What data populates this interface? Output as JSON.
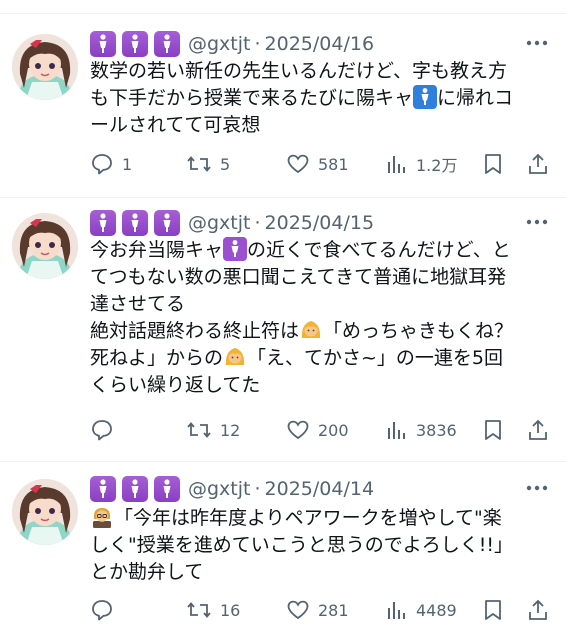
{
  "colors": {
    "text": "#0f1419",
    "secondary": "#536471",
    "badge_purple": "#9b4fd1",
    "badge_blue": "#2f7fdd",
    "divider": "#eff3f4"
  },
  "tweets": [
    {
      "handle": "@gxtjt",
      "sep": "·",
      "date": "2025/04/16",
      "lines": [
        [
          "数学の若い新任の先生いるんだけど、字も教え方"
        ],
        [
          "も下手だから授業で来るたびに陽キャ",
          "に帰れコ"
        ],
        [
          "ールされてて可哀想"
        ]
      ],
      "replies": "1",
      "retweets": "5",
      "likes": "581",
      "views": "1.2万"
    },
    {
      "handle": "@gxtjt",
      "sep": "·",
      "date": "2025/04/15",
      "lines": [
        [
          "今お弁当陽キャ",
          "の近くで食べてるんだけど、と"
        ],
        [
          "てつもない数の悪口聞こえてきて普通に地獄耳発"
        ],
        [
          "達させてる"
        ],
        [
          "絶対話題終わる終止符は",
          "「めっちゃきもくね？"
        ],
        [
          "死ねよ」からの",
          "「え、てかさ~」の一連を5回"
        ],
        [
          "くらい繰り返してた"
        ]
      ],
      "replies": "",
      "retweets": "12",
      "likes": "200",
      "views": "3836"
    },
    {
      "handle": "@gxtjt",
      "sep": "·",
      "date": "2025/04/14",
      "lines": [
        [
          "「今年は昨年度よりペアワークを増やして\"楽"
        ],
        [
          "しく\"授業を進めていこうと思うのでよろしく!!」"
        ],
        [
          "とか勘弁して"
        ]
      ],
      "replies": "",
      "retweets": "16",
      "likes": "281",
      "views": "4489"
    }
  ]
}
